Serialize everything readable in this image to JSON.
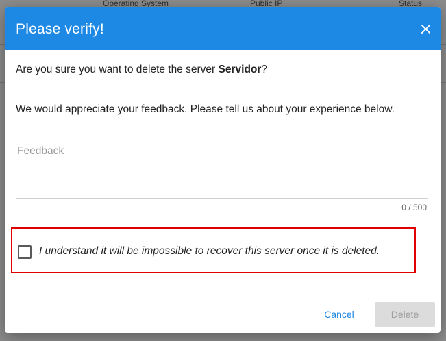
{
  "background": {
    "table_headers": [
      "Operating System",
      "Public IP",
      "Status"
    ]
  },
  "dialog": {
    "title": "Please verify!",
    "close_icon": "close-icon",
    "question_prefix": "Are you sure you want to delete the server ",
    "server_name": "Servidor",
    "question_suffix": "?",
    "feedback_prompt": "We would appreciate your feedback. Please tell us about your experience below.",
    "feedback": {
      "placeholder": "Feedback",
      "value": "",
      "counter": "0 / 500"
    },
    "confirm": {
      "checked": false,
      "label": "I understand it will be impossible to recover this server once it is deleted."
    },
    "actions": {
      "cancel_label": "Cancel",
      "delete_label": "Delete",
      "delete_enabled": false
    }
  },
  "colors": {
    "header": "#1e88e5",
    "accent": "#1e88e5",
    "highlight_border": "#e00000",
    "disabled_button": "#dcdcdc"
  }
}
